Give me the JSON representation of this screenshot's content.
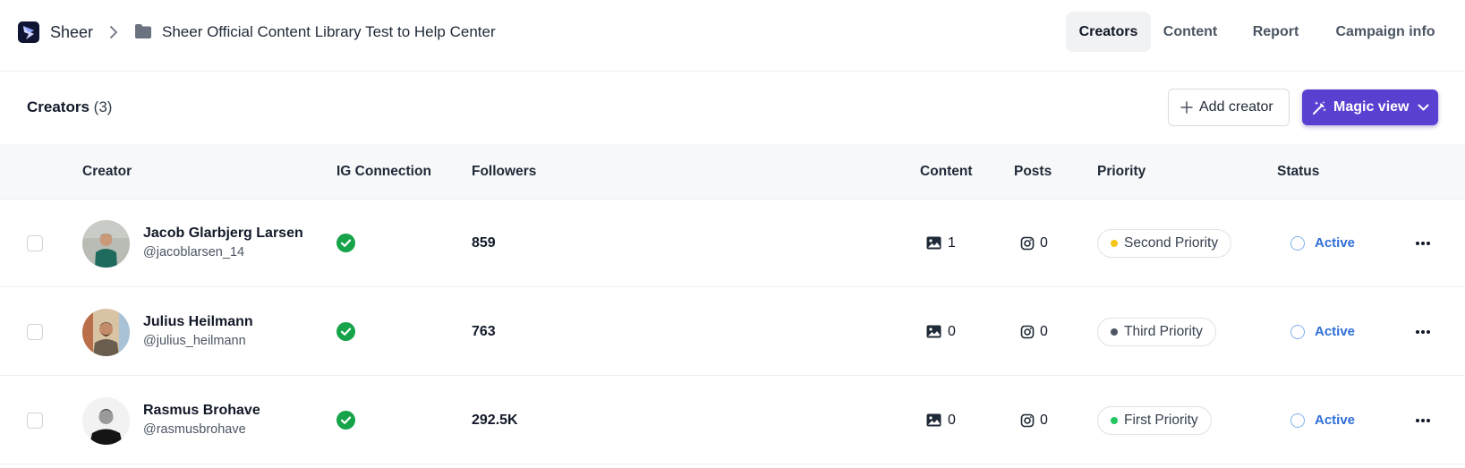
{
  "breadcrumb": {
    "root": "Sheer",
    "page": "Sheer Official Content Library Test to Help Center"
  },
  "nav": {
    "tabs": [
      {
        "label": "Creators",
        "active": true
      },
      {
        "label": "Content",
        "active": false
      },
      {
        "label": "Report",
        "active": false
      },
      {
        "label": "Campaign info",
        "active": false
      }
    ]
  },
  "section": {
    "title": "Creators",
    "count": "(3)",
    "add_button": "Add creator",
    "magic_button": "Magic view"
  },
  "table": {
    "columns": [
      "Creator",
      "IG Connection",
      "Followers",
      "Content",
      "Posts",
      "Priority",
      "Status"
    ],
    "rows": [
      {
        "name": "Jacob Glarbjerg Larsen",
        "handle": "@jacoblarsen_14",
        "ig_connected": true,
        "followers": "859",
        "content": "1",
        "posts": "0",
        "priority": "Second Priority",
        "priority_color": "#f5c518",
        "status": "Active"
      },
      {
        "name": "Julius Heilmann",
        "handle": "@julius_heilmann",
        "ig_connected": true,
        "followers": "763",
        "content": "0",
        "posts": "0",
        "priority": "Third Priority",
        "priority_color": "#4b5563",
        "status": "Active"
      },
      {
        "name": "Rasmus Brohave",
        "handle": "@rasmusbrohave",
        "ig_connected": true,
        "followers": "292.5K",
        "content": "0",
        "posts": "0",
        "priority": "First Priority",
        "priority_color": "#22c55e",
        "status": "Active"
      }
    ]
  },
  "colors": {
    "accent": "#5b3fd0",
    "status_blue": "#2f6fd6",
    "ig_ok": "#16a34a"
  },
  "icons": {
    "logo": "sheer-logo-icon",
    "breadcrumb_separator": "chevron-right-icon",
    "folder": "folder-icon",
    "add": "plus-icon",
    "magic": "magic-wand-icon",
    "dropdown": "chevron-down-icon",
    "ig_connection": "check-circle-icon",
    "content": "image-icon",
    "posts": "instagram-icon",
    "status": "circle-icon",
    "row_menu": "more-horizontal-icon"
  }
}
